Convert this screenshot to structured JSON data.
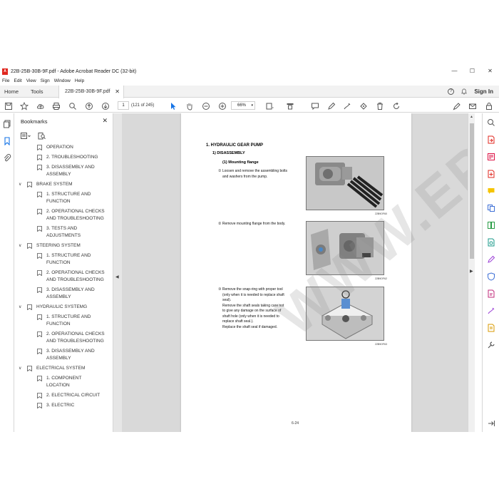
{
  "window": {
    "title": "22B-25B-30B-9F.pdf - Adobe Acrobat Reader DC (32-bit)",
    "controls": [
      "—",
      "☐",
      "✕"
    ]
  },
  "menu": [
    "File",
    "Edit",
    "View",
    "Sign",
    "Window",
    "Help"
  ],
  "tabs": {
    "home": "Home",
    "tools": "Tools",
    "document": "22B-25B-30B-9F.pdf",
    "close": "✕",
    "help": "?",
    "sign_in": "Sign In"
  },
  "toolbar": {
    "page_current": "1",
    "page_count": "(121 of 245)",
    "zoom": "66%"
  },
  "bookmarks": {
    "title": "Bookmarks",
    "close": "✕",
    "items": [
      {
        "level": 2,
        "text": [
          "OPERATION"
        ]
      },
      {
        "level": 2,
        "text": [
          "2. TROUBLESHOOTING"
        ]
      },
      {
        "level": 2,
        "text": [
          "3. DISASSEMBLY AND",
          "ASSEMBLY"
        ]
      },
      {
        "level": 1,
        "text": [
          "BRAKE SYSTEM"
        ]
      },
      {
        "level": 2,
        "text": [
          "1. STRUCTURE AND",
          "FUNCTION"
        ]
      },
      {
        "level": 2,
        "text": [
          "2. OPERATIONAL CHECKS",
          "AND TROUBLESHOOTING"
        ]
      },
      {
        "level": 2,
        "text": [
          "3. TESTS AND",
          "ADJUSTMENTS"
        ]
      },
      {
        "level": 1,
        "text": [
          "STEERING SYSTEM"
        ]
      },
      {
        "level": 2,
        "text": [
          "1. STRUCTURE AND",
          "FUNCTION"
        ]
      },
      {
        "level": 2,
        "text": [
          "2. OPERATIONAL CHECKS",
          "AND TROUBLESHOOTING"
        ]
      },
      {
        "level": 2,
        "text": [
          "3. DISASSEMBLY AND",
          "ASSEMBLY"
        ]
      },
      {
        "level": 1,
        "text": [
          "HYDRAULIC SYSTEMG"
        ]
      },
      {
        "level": 2,
        "text": [
          "1. STRUCTURE AND",
          "FUNCTION"
        ]
      },
      {
        "level": 2,
        "text": [
          "2. OPERATIONAL CHECKS",
          "AND TROUBLESHOOTING"
        ]
      },
      {
        "level": 2,
        "text": [
          "3. DISASSEMBLY AND",
          "ASSEMBLY"
        ]
      },
      {
        "level": 1,
        "text": [
          "ELECTRICAL SYSTEM"
        ]
      },
      {
        "level": 2,
        "text": [
          "1. COMPONENT",
          "LOCATION"
        ]
      },
      {
        "level": 2,
        "text": [
          "2. ELECTRICAL CIRCUIT"
        ]
      },
      {
        "level": 2,
        "text": [
          "3. ELECTRIC"
        ]
      }
    ]
  },
  "document": {
    "heading1": "1. HYDRAULIC GEAR PUMP",
    "heading2": "1) DISASSEMBLY",
    "heading3": "(1) Mounting flange",
    "step1": [
      "① Loosen and remove the assembling bolts",
      "and washers from the pump."
    ],
    "step2": [
      "② Remove mounting flange from the body."
    ],
    "step3": [
      "③ Remove the snap-ring with proper tool",
      "(only when it is needed to replace shaft",
      "seal).",
      "Remove the shaft seals taking care not",
      "to give any damage on the surface of",
      "shaft hole (only when it is needed to",
      "replace shaft seal.).",
      "Replace the shaft seal if damaged."
    ],
    "fig_codes": [
      "22B9OF60",
      "22B9OF62",
      "22B9OF63"
    ],
    "page_number": "6-24",
    "watermark": "WWW.EPCDEPOT.COM"
  },
  "colors": {
    "acrobat_red": "#e0271f",
    "panel_bg": "#ffffff",
    "doc_bg": "#d9d9d9"
  }
}
